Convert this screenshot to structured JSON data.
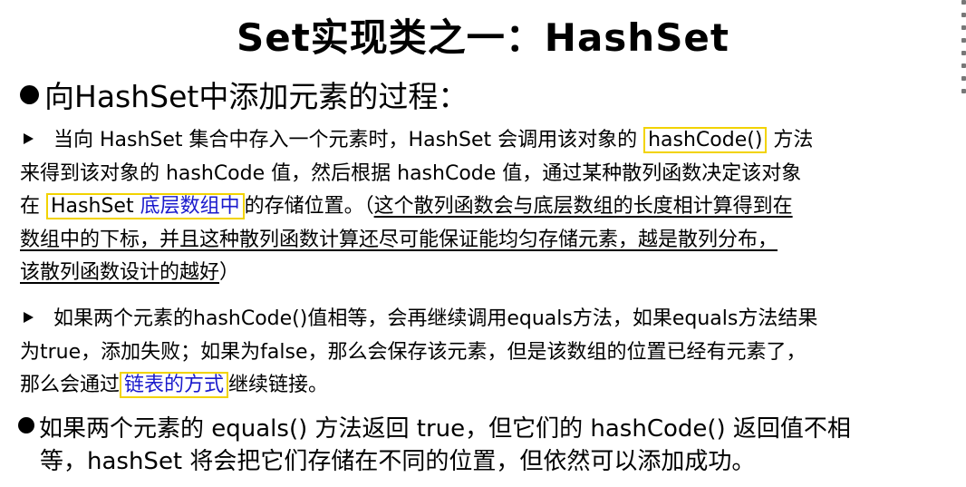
{
  "slide": {
    "title": "Set实现类之一：HashSet",
    "heading": "向HashSet中添加元素的过程：",
    "p1": {
      "l1a": "当向 HashSet 集合中存入一个元素时，HashSet 会调用该对象的",
      "l1hl": "hashCode()",
      "l1b": "方法",
      "l2": "来得到该对象的 hashCode 值，然后根据 hashCode 值，通过某种散列函数决定该对象",
      "l3a": "在",
      "l3hl1": "HashSet ",
      "l3hl2": "底层数组中",
      "l3b": "的存储位置。（",
      "l3u": "这个散列函数会与底层数组的长度相计算得到在",
      "l4u": "数组中的下标，并且这种散列函数计算还尽可能保证能均匀存储元素，越是散列分布，",
      "l5u": "该散列函数设计的越好",
      "l5b": "）"
    },
    "p2": {
      "l1": "如果两个元素的hashCode()值相等，会再继续调用equals方法，如果equals方法结果",
      "l2": "为true，添加失败；如果为false，那么会保存该元素，但是该数组的位置已经有元素了，",
      "l3a": "那么会通过",
      "l3hl": "链表的方式",
      "l3b": "继续链接。"
    },
    "p3": {
      "l1": "如果两个元素的 equals() 方法返回 true，但它们的 hashCode() 返回值不相",
      "l2": "等，hashSet 将会把它们存储在不同的位置，但依然可以添加成功。"
    }
  }
}
